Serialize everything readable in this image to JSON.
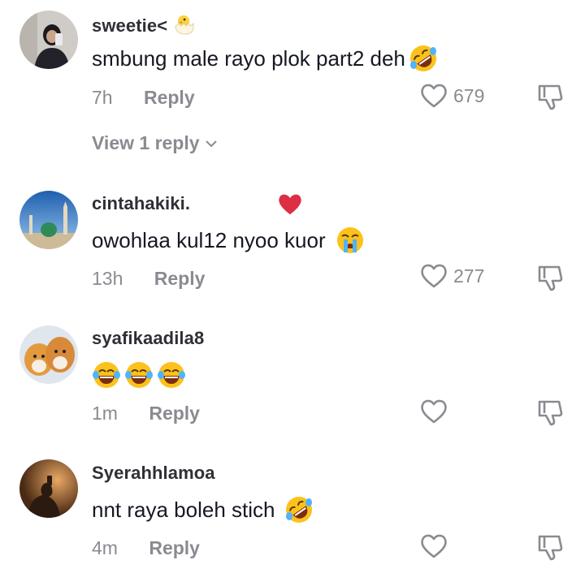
{
  "comments": [
    {
      "username": "sweetie<",
      "text": "smbung male rayo plok part2 deh",
      "time": "7h",
      "reply_label": "Reply",
      "likes": "679",
      "view_replies": "View 1 reply",
      "username_icon": "chick-emoji-icon",
      "text_emojis": [
        "rolling-laughing-emoji-icon"
      ]
    },
    {
      "username": "cintahakiki.",
      "text": "owohlaa kul12 nyoo kuor",
      "time": "13h",
      "reply_label": "Reply",
      "likes": "277",
      "username_icon": "red-heart-emoji-icon",
      "text_emojis": [
        "loudly-crying-emoji-icon"
      ]
    },
    {
      "username": "syafikaadila8",
      "text": "",
      "time": "1m",
      "reply_label": "Reply",
      "likes": "",
      "text_emojis": [
        "joy-emoji-icon",
        "joy-emoji-icon",
        "joy-emoji-icon"
      ]
    },
    {
      "username": "Syerahhlamoa",
      "text": "nnt raya boleh stich",
      "time": "4m",
      "reply_label": "Reply",
      "likes": "",
      "text_emojis": [
        "rolling-laughing-emoji-icon"
      ]
    }
  ],
  "colors": {
    "text": "#161823",
    "secondary": "#8a8b91",
    "heart": "#e0202e",
    "emoji_yellow": "#fcc21b"
  }
}
